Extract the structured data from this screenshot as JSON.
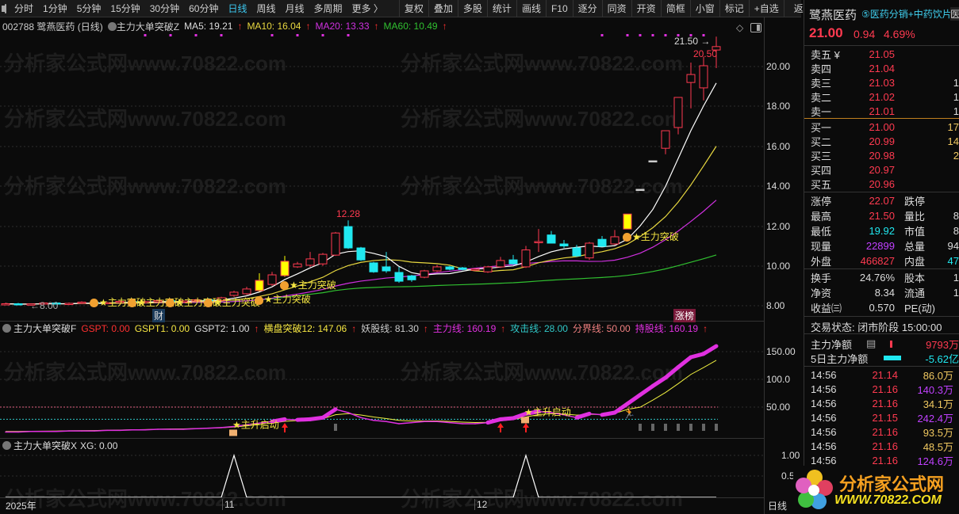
{
  "toolbar": {
    "periods": [
      "分时",
      "1分钟",
      "5分钟",
      "15分钟",
      "30分钟",
      "60分钟",
      "日线",
      "周线",
      "月线",
      "多周期",
      "更多 〉"
    ],
    "active": "日线",
    "tools": [
      "复权",
      "叠加",
      "多股",
      "统计",
      "画线",
      "F10",
      "逐分",
      "同资",
      "开资",
      "简框",
      "小窗",
      "标记",
      "+自选",
      "返回"
    ]
  },
  "info": {
    "code_name": "002788 鹭燕医药 (日线)",
    "indicator": "主力大单突破Z",
    "ma5": "MA5: 19.21",
    "ma10": "MA10: 16.04",
    "ma20": "MA20: 13.33",
    "ma60": "MA60: 10.49",
    "arrow": "↑"
  },
  "sub1_info": {
    "name": "主力大单突破F",
    "gspt": "GSPT: 0.00",
    "gspt1": "GSPT1: 0.00",
    "gspt2": "GSPT2: 1.00",
    "hp": "横盘突破12: 147.06",
    "ygx": "妖股线: 81.30",
    "zlx": "主力线: 160.19",
    "gjx": "攻击线: 28.00",
    "fjx": "分界线: 50.00",
    "cgx": "持股线: 160.19"
  },
  "sub2_info": {
    "name": "主力大单突破X",
    "xg": "XG: 0.00"
  },
  "axis": {
    "main": [
      "20.00",
      "18.00",
      "16.00",
      "14.00",
      "12.00",
      "10.00",
      "8.00"
    ],
    "sub1": [
      "150.00",
      "100.0",
      "50.00"
    ],
    "sub2": [
      "1.00",
      "0.5"
    ],
    "x": [
      "2025年",
      "11",
      "12"
    ],
    "period": "日线"
  },
  "annotations": {
    "high": "12.28",
    "top": "21.50",
    "top_arrow": "21.50",
    "last_high": "20.50",
    "low": "←8.00",
    "cai": "财",
    "zhangbang": "涨榜",
    "signal": "★主力突破",
    "start": "★主升启动"
  },
  "watermark": "分析家公式网www.70822.com",
  "colors": {
    "up": "#ff3a50",
    "down": "#20e8f0",
    "signal": "#ffff00",
    "ma5": "#ffffff",
    "ma10": "#e8d840",
    "ma20": "#d030e0",
    "ma60": "#30c030"
  },
  "candles": [
    [
      8.08,
      8.15,
      8.02,
      8.1
    ],
    [
      8.1,
      8.14,
      8.04,
      8.06
    ],
    [
      8.06,
      8.12,
      8.0,
      8.09
    ],
    [
      8.09,
      8.18,
      8.05,
      8.14
    ],
    [
      8.14,
      8.2,
      8.08,
      8.1
    ],
    [
      8.1,
      8.16,
      8.03,
      8.12
    ],
    [
      8.12,
      8.22,
      8.08,
      8.18
    ],
    [
      8.18,
      8.24,
      8.1,
      8.13
    ],
    [
      8.13,
      8.2,
      8.08,
      8.16
    ],
    [
      8.16,
      8.26,
      8.12,
      8.22
    ],
    [
      8.22,
      8.28,
      8.14,
      8.17
    ],
    [
      8.17,
      8.25,
      8.12,
      8.21
    ],
    [
      8.21,
      8.3,
      8.16,
      8.26
    ],
    [
      8.26,
      8.32,
      8.18,
      8.2
    ],
    [
      8.2,
      8.28,
      8.15,
      8.24
    ],
    [
      8.24,
      8.34,
      8.2,
      8.3
    ],
    [
      8.3,
      8.38,
      8.24,
      8.27
    ],
    [
      8.27,
      8.45,
      8.24,
      8.4
    ],
    [
      8.52,
      8.75,
      8.45,
      8.68
    ],
    [
      8.6,
      8.95,
      8.55,
      8.84
    ],
    [
      8.76,
      9.63,
      8.7,
      9.27
    ],
    [
      9.07,
      9.7,
      9.0,
      9.55
    ],
    [
      9.51,
      10.5,
      9.45,
      10.23
    ],
    [
      9.95,
      10.2,
      9.9,
      10.1
    ],
    [
      10.03,
      10.7,
      9.95,
      10.35
    ],
    [
      10.1,
      10.65,
      10.0,
      10.58
    ],
    [
      10.54,
      11.7,
      10.5,
      11.65
    ],
    [
      11.97,
      12.28,
      10.85,
      10.9
    ],
    [
      10.9,
      10.95,
      10.25,
      10.3
    ],
    [
      10.15,
      10.2,
      9.65,
      9.7
    ],
    [
      9.95,
      10.7,
      9.65,
      9.75
    ],
    [
      9.67,
      9.95,
      9.15,
      9.23
    ],
    [
      9.5,
      9.55,
      9.2,
      9.3
    ],
    [
      9.43,
      9.8,
      9.38,
      9.75
    ],
    [
      9.75,
      10.05,
      9.7,
      9.95
    ],
    [
      9.95,
      10.0,
      9.78,
      9.83
    ],
    [
      9.9,
      9.95,
      9.78,
      9.82
    ],
    [
      9.8,
      9.88,
      9.74,
      9.84
    ],
    [
      9.7,
      10.0,
      9.65,
      9.95
    ],
    [
      9.95,
      10.45,
      9.9,
      10.27
    ],
    [
      10.3,
      10.55,
      10.05,
      10.1
    ],
    [
      9.95,
      11.0,
      9.9,
      10.8
    ],
    [
      11.2,
      11.85,
      10.7,
      11.22
    ],
    [
      11.55,
      11.75,
      11.14,
      11.14
    ],
    [
      11.1,
      11.3,
      10.9,
      11.0
    ],
    [
      10.9,
      11.05,
      10.45,
      10.5
    ],
    [
      10.4,
      11.2,
      10.3,
      11.14
    ],
    [
      11.33,
      11.5,
      10.98,
      10.98
    ],
    [
      11.1,
      11.8,
      11.05,
      11.46
    ],
    [
      11.85,
      12.6,
      11.85,
      12.6
    ],
    [
      13.84,
      13.84,
      13.84,
      13.84
    ],
    [
      15.27,
      15.27,
      15.27,
      15.27
    ],
    [
      15.9,
      16.78,
      15.6,
      16.78
    ],
    [
      16.94,
      18.45,
      16.6,
      18.45
    ],
    [
      19.2,
      20.2,
      17.9,
      19.6
    ],
    [
      18.93,
      20.5,
      18.3,
      20.04
    ],
    [
      20.83,
      21.5,
      19.92,
      21.0
    ]
  ],
  "signal_candles": [
    20,
    22,
    49
  ],
  "signal_labels": [
    7,
    10,
    13,
    16,
    20,
    22,
    49
  ],
  "top_dots": [
    11,
    13,
    15,
    17,
    21,
    23,
    25,
    27,
    47,
    49,
    50,
    51,
    52,
    53,
    54,
    55
  ],
  "main_force_line": [
    5,
    5,
    6,
    6,
    6,
    7,
    7,
    7,
    8,
    8,
    9,
    9,
    10,
    10,
    10,
    11,
    12,
    13,
    15,
    18,
    21,
    24,
    28,
    27,
    28,
    31,
    46,
    40,
    31,
    26,
    24,
    20,
    22,
    24,
    24,
    22,
    20,
    20,
    22,
    28,
    30,
    38,
    42,
    40,
    36,
    31,
    38,
    36,
    40,
    56,
    72,
    88,
    103,
    122,
    140,
    146,
    160
  ],
  "boundary_line": 50,
  "attack_line": 28,
  "sub1_markers": {
    "start": [
      18,
      41
    ],
    "red_arrows": [
      22,
      39,
      41
    ],
    "gray_bars": [
      26,
      50,
      51,
      52,
      53,
      54,
      55,
      56
    ],
    "runner": 49
  },
  "xg": {
    "ones": [
      18,
      41
    ]
  },
  "panel": {
    "name": "鹭燕医药",
    "concept": "⑤医药分销+中药饮片",
    "extra": "医",
    "price": "21.00",
    "change": "0.94",
    "pct": "4.69%",
    "sell": [
      {
        "l": "卖五 ¥",
        "p": "21.05",
        "v": ""
      },
      {
        "l": "卖四",
        "p": "21.04",
        "v": ""
      },
      {
        "l": "卖三",
        "p": "21.03",
        "v": "1"
      },
      {
        "l": "卖二",
        "p": "21.02",
        "v": "1"
      },
      {
        "l": "卖一",
        "p": "21.01",
        "v": "1"
      }
    ],
    "buy": [
      {
        "l": "买一",
        "p": "21.00",
        "v": "17"
      },
      {
        "l": "买二",
        "p": "20.99",
        "v": "14"
      },
      {
        "l": "买三",
        "p": "20.98",
        "v": "2"
      },
      {
        "l": "买四",
        "p": "20.97",
        "v": ""
      },
      {
        "l": "买五",
        "p": "20.96",
        "v": ""
      }
    ],
    "stats": [
      {
        "l": "涨停",
        "v": "22.07",
        "c": "red",
        "l2": "跌停",
        "v2": ""
      },
      {
        "l": "最高",
        "v": "21.50",
        "c": "red",
        "l2": "量比",
        "v2": "8"
      },
      {
        "l": "最低",
        "v": "19.92",
        "c": "cyan",
        "l2": "市值",
        "v2": "8"
      },
      {
        "l": "现量",
        "v": "22899",
        "c": "mag",
        "l2": "总量",
        "v2": "94"
      },
      {
        "l": "外盘",
        "v": "466827",
        "c": "red",
        "l2": "内盘",
        "v2": "47"
      }
    ],
    "fin": [
      {
        "l": "换手",
        "v": "24.76%",
        "l2": "股本",
        "v2": "1"
      },
      {
        "l": "净资",
        "v": "8.34",
        "l2": "流通",
        "v2": "1"
      },
      {
        "l": "收益㈢",
        "v": "0.570",
        "l2": "PE(动)",
        "v2": ""
      }
    ],
    "status": "交易状态: 闭市阶段 15:00:00",
    "main_net_label": "主力净额",
    "main_net": "9793万",
    "five_net_label": "5日主力净额",
    "five_net": "-5.62亿",
    "ticks": [
      {
        "t": "14:56",
        "p": "21.14",
        "a": "86.0万",
        "c": "yel"
      },
      {
        "t": "14:56",
        "p": "21.16",
        "a": "140.3万",
        "c": "mag"
      },
      {
        "t": "14:56",
        "p": "21.16",
        "a": "34.1万",
        "c": "yel"
      },
      {
        "t": "14:56",
        "p": "21.15",
        "a": "242.4万",
        "c": "mag"
      },
      {
        "t": "14:56",
        "p": "21.16",
        "a": "93.5万",
        "c": "yel"
      },
      {
        "t": "14:56",
        "p": "21.16",
        "a": "48.5万",
        "c": "yel"
      },
      {
        "t": "14:56",
        "p": "21.16",
        "a": "124.6万",
        "c": "mag"
      }
    ]
  },
  "logo": {
    "title": "分析家公式网",
    "url": "WWW.70822.COM"
  }
}
